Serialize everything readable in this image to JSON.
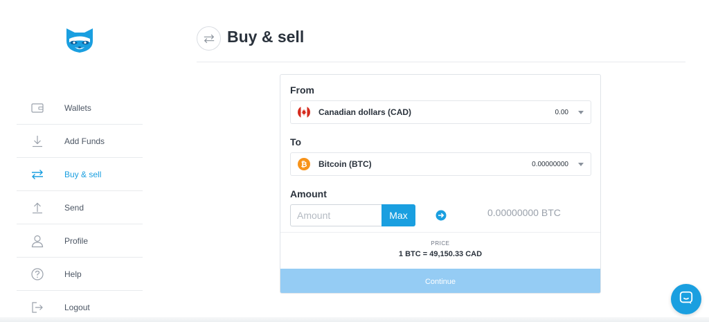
{
  "brand": {
    "logo_icon": "raccoon-logo-icon",
    "color": "#1a9fe0"
  },
  "sidebar": {
    "items": [
      {
        "label": "Wallets",
        "icon": "wallet-icon",
        "active": false
      },
      {
        "label": "Add Funds",
        "icon": "download-icon",
        "active": false
      },
      {
        "label": "Buy & sell",
        "icon": "swap-icon",
        "active": true
      },
      {
        "label": "Send",
        "icon": "upload-icon",
        "active": false
      },
      {
        "label": "Profile",
        "icon": "user-icon",
        "active": false
      },
      {
        "label": "Help",
        "icon": "help-icon",
        "active": false
      },
      {
        "label": "Logout",
        "icon": "logout-icon",
        "active": false
      }
    ]
  },
  "header": {
    "title": "Buy & sell",
    "icon": "swap-icon"
  },
  "form": {
    "from": {
      "label": "From",
      "currency": "Canadian dollars (CAD)",
      "balance": "0.00",
      "icon": "canada-flag-icon"
    },
    "to": {
      "label": "To",
      "currency": "Bitcoin (BTC)",
      "balance": "0.00000000",
      "icon": "bitcoin-icon"
    },
    "amount": {
      "label": "Amount",
      "placeholder": "Amount",
      "value": "",
      "max_label": "Max",
      "converted": "0.00000000 BTC"
    },
    "price": {
      "label": "PRICE",
      "value": "1 BTC = 49,150.33 CAD"
    },
    "continue_label": "Continue"
  },
  "colors": {
    "accent": "#1a9fe0",
    "continue_disabled": "#95ccf4",
    "canada_red": "#d52b1e",
    "bitcoin_orange": "#f7931a"
  }
}
